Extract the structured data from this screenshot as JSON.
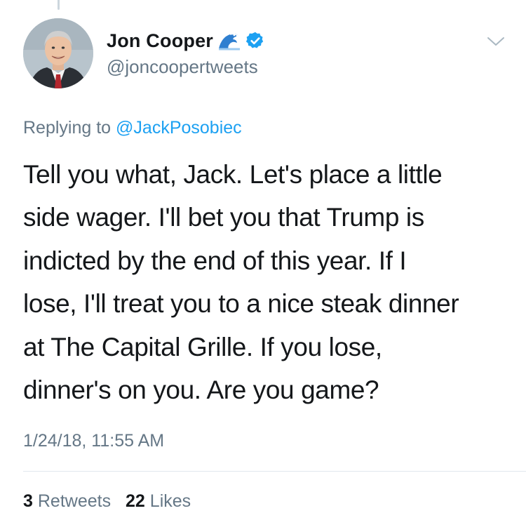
{
  "tweet": {
    "display_name": "Jon Cooper",
    "name_emoji_icon": "wave-icon",
    "verified_icon": "verified-badge-icon",
    "handle": "@joncoopertweets",
    "replying_to_prefix": "Replying to",
    "replying_to_handle": "@JackPosobiec",
    "text_lines": [
      "Tell you what, Jack. Let's place a little",
      "side wager. I'll bet you that Trump is",
      "indicted by the end of this year. If I",
      "lose, I'll treat you to a nice steak dinner",
      "at The Capital Grille. If you lose,",
      "dinner's on you. Are you game?"
    ],
    "timestamp": "1/24/18, 11:55 AM",
    "retweets_count": "3",
    "retweets_label": "Retweets",
    "likes_count": "22",
    "likes_label": "Likes"
  },
  "colors": {
    "link_blue": "#1da1f2",
    "secondary_gray": "#657786",
    "primary_text": "#14171a",
    "divider": "#e1e8ed"
  }
}
